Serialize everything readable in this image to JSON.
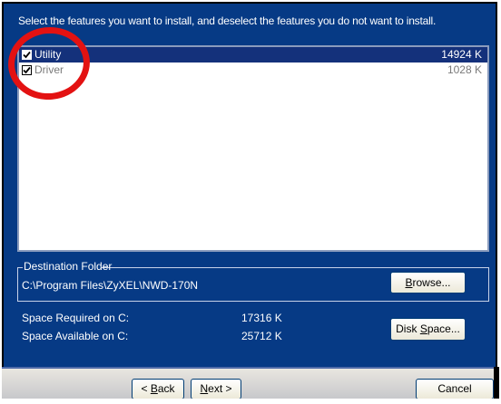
{
  "instruction": "Select the features you want to install, and deselect the features you do not want to install.",
  "features": [
    {
      "name": "Utility",
      "size": "14924 K",
      "checked": true,
      "selected": true
    },
    {
      "name": "Driver",
      "size": "1028 K",
      "checked": true,
      "selected": false
    }
  ],
  "destination": {
    "legend": "Destination Folder",
    "path": "C:\\Program Files\\ZyXEL\\NWD-170N",
    "browse_label": "Browse..."
  },
  "space": {
    "required_label": "Space Required on C:",
    "required_value": "17316 K",
    "available_label": "Space Available on C:",
    "available_value": "25712 K",
    "disk_space_label": "Disk Space..."
  },
  "footer": {
    "back_label": "< Back",
    "next_label": "Next >",
    "cancel_label": "Cancel"
  },
  "colors": {
    "dialog_background": "#063a85",
    "selection_highlight": "#14317b",
    "annotation_ring": "#e31212"
  },
  "icons": {
    "checkbox": "checkmark-icon"
  }
}
